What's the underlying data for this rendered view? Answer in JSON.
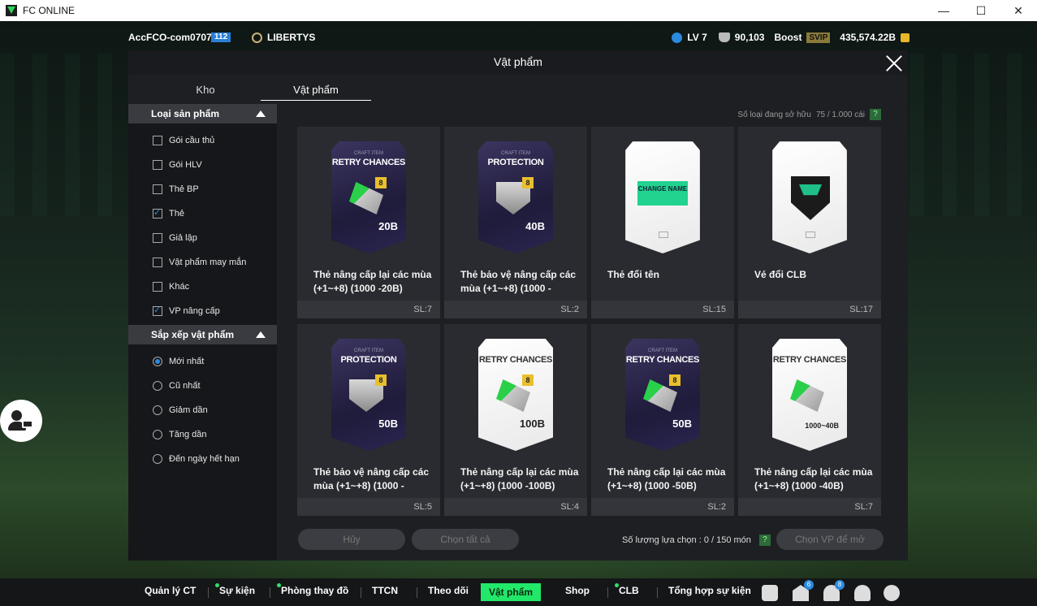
{
  "window": {
    "title": "FC ONLINE",
    "controls": [
      "—",
      "☐",
      "✕"
    ]
  },
  "topbar": {
    "account_name": "AccFCO-com0707d",
    "account_badge": "112",
    "club_name": "LIBERTYS",
    "level": "LV 7",
    "trophies": "90,103",
    "boost_label": "Boost",
    "svip_label": "SVIP",
    "coins": "435,574.22B"
  },
  "dialog": {
    "title": "Vật phẩm",
    "tabs": [
      "Kho",
      "Vật phẩm"
    ],
    "active_tab": "Vật phẩm",
    "owned_label": "Số loại đang sở hữu",
    "owned_value": "75 / 1.000 cái",
    "help_label": "?",
    "filter": {
      "title": "Loại sản phẩm",
      "options": [
        {
          "label": "Gói cầu thủ",
          "checked": false
        },
        {
          "label": "Gói HLV",
          "checked": false
        },
        {
          "label": "Thẻ BP",
          "checked": false
        },
        {
          "label": "Thẻ",
          "checked": true
        },
        {
          "label": "Giả lập",
          "checked": false
        },
        {
          "label": "Vật phẩm may mắn",
          "checked": false
        },
        {
          "label": "Khác",
          "checked": false
        },
        {
          "label": "VP nâng cấp",
          "checked": true
        }
      ]
    },
    "sort": {
      "title": "Sắp xếp vật phẩm",
      "options": [
        {
          "label": "Mới nhất",
          "selected": true
        },
        {
          "label": "Cũ nhất",
          "selected": false
        },
        {
          "label": "Giảm dần",
          "selected": false
        },
        {
          "label": "Tăng dần",
          "selected": false
        },
        {
          "label": "Đến ngày hết hạn",
          "selected": false
        }
      ]
    },
    "items": [
      {
        "name": "Thẻ nâng cấp lại các mùa (+1~+8) (1000 -20B)",
        "qty": "SL:7",
        "pack_sub": "CRAFT ITEM",
        "pack_title": "RETRY CHANCES",
        "pack_value": "20B",
        "style": "dark",
        "level": "8"
      },
      {
        "name": "Thẻ bảo vệ nâng cấp các mùa (+1~+8) (1000 -",
        "qty": "SL:2",
        "pack_sub": "CRAFT ITEM",
        "pack_title": "PROTECTION",
        "pack_value": "40B",
        "style": "dark",
        "level": "8"
      },
      {
        "name": "Thẻ đổi tên",
        "qty": "SL:15",
        "pack_sub": "",
        "pack_title": "",
        "pack_value": "",
        "style": "white-name",
        "level": "",
        "art_text": "CHANGE NAME"
      },
      {
        "name": "Vé đổi CLB",
        "qty": "SL:17",
        "pack_sub": "",
        "pack_title": "",
        "pack_value": "",
        "style": "white-club",
        "level": ""
      },
      {
        "name": "Thẻ bảo vệ nâng cấp các mùa (+1~+8) (1000 -",
        "qty": "SL:5",
        "pack_sub": "CRAFT ITEM",
        "pack_title": "PROTECTION",
        "pack_value": "50B",
        "style": "dark",
        "level": "8"
      },
      {
        "name": "Thẻ nâng cấp lại các mùa (+1~+8) (1000 -100B)",
        "qty": "SL:4",
        "pack_sub": "",
        "pack_title": "RETRY CHANCES",
        "pack_value": "100B",
        "style": "white",
        "level": "8"
      },
      {
        "name": "Thẻ nâng cấp lại các mùa (+1~+8) (1000 -50B)",
        "qty": "SL:2",
        "pack_sub": "CRAFT ITEM",
        "pack_title": "RETRY CHANCES",
        "pack_value": "50B",
        "style": "dark",
        "level": "8"
      },
      {
        "name": "Thẻ nâng cấp lại các mùa (+1~+8) (1000 -40B)",
        "qty": "SL:7",
        "pack_sub": "",
        "pack_title": "RETRY CHANCES",
        "pack_value": "1000~40B",
        "style": "white",
        "level": ""
      }
    ],
    "footer": {
      "cancel_label": "Hủy",
      "select_all_label": "Chọn tất cả",
      "selection_label": "Số lượng lựa chọn : 0 / 150 món",
      "confirm_label": "Chọn VP để mở"
    }
  },
  "bottom_nav": [
    {
      "label": "Quản lý CT",
      "dot": false,
      "active": false
    },
    {
      "label": "Sự kiện",
      "dot": true,
      "active": false
    },
    {
      "label": "Phòng thay đồ",
      "dot": true,
      "active": false
    },
    {
      "label": "TTCN",
      "dot": false,
      "active": false
    },
    {
      "label": "Theo dõi",
      "dot": false,
      "active": false
    },
    {
      "label": "Vật phẩm",
      "dot": false,
      "active": true
    },
    {
      "label": "Shop",
      "dot": false,
      "active": false
    },
    {
      "label": "CLB",
      "dot": true,
      "active": false
    },
    {
      "label": "Tổng hợp sự kiện",
      "dot": false,
      "active": false
    }
  ],
  "bottom_icons": [
    {
      "name": "chat-icon",
      "badge": ""
    },
    {
      "name": "mail-icon",
      "badge": "6"
    },
    {
      "name": "bell-icon",
      "badge": "8"
    },
    {
      "name": "profile-icon",
      "badge": ""
    },
    {
      "name": "settings-icon",
      "badge": ""
    }
  ],
  "colors": {
    "accent": "#22e86a",
    "checkbox_accent": "#2b8ae0",
    "dialog_bg": "#1e1f23"
  }
}
